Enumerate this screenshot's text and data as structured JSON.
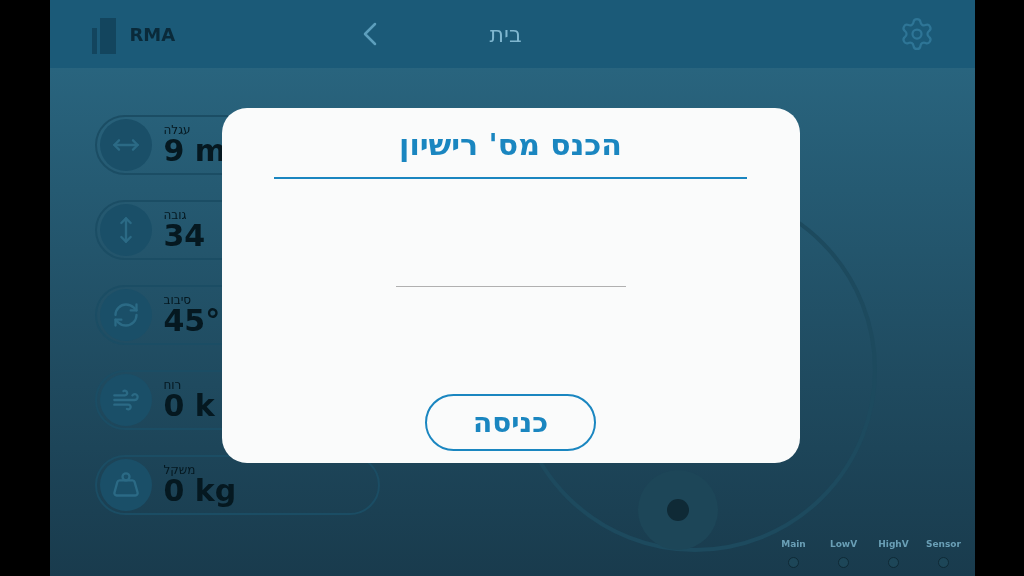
{
  "header": {
    "logo_text": "RMA",
    "title": "בית"
  },
  "stats": [
    {
      "label": "עגלה",
      "value": "9 m"
    },
    {
      "label": "גובה",
      "value": "34"
    },
    {
      "label": "סיבוב",
      "value": "45°"
    },
    {
      "label": "רוח",
      "value": "0 k"
    },
    {
      "label": "משקל",
      "value": "0 kg"
    }
  ],
  "indicators": [
    {
      "label": "Sensor"
    },
    {
      "label": "HighV"
    },
    {
      "label": "LowV"
    },
    {
      "label": "Main"
    }
  ],
  "dialog": {
    "title": "הכנס מס' רישיון",
    "button": "כניסה"
  }
}
